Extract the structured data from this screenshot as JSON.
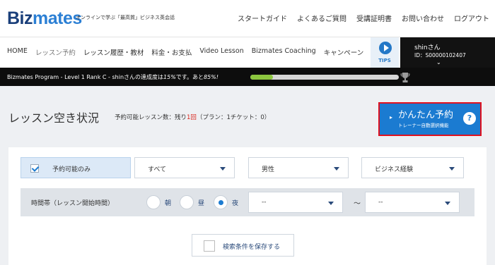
{
  "brand": {
    "logo_main": "Biz",
    "logo_accent": "mates",
    "tagline": "オンラインで学ぶ「最高質」ビジネス英会話"
  },
  "top_links": [
    "スタートガイド",
    "よくあるご質問",
    "受講証明書",
    "お問い合わせ",
    "ログアウト"
  ],
  "nav": {
    "items": [
      "HOME",
      "レッスン予約",
      "レッスン履歴・教材",
      "料金・お支払",
      "Video Lesson",
      "Bizmates Coaching",
      "キャンペーン"
    ],
    "tips_label": "TIPS",
    "user_name": "shinさん",
    "user_id": "ID：S00000102407"
  },
  "progress": {
    "text_prefix": "Bizmates Program - Level 1 Rank C - shinさんの達成度は",
    "achieved": "15%",
    "text_middle": "です。あと",
    "remaining": "85%!",
    "fraction": 0.15
  },
  "page": {
    "title": "レッスン空き状況",
    "remaining_prefix": "予約可能レッスン数：残り",
    "remaining_count": "1回",
    "remaining_suffix": "（プラン：1チケット：0）"
  },
  "reserve": {
    "main": "かんたん予約",
    "sub": "トレーナー自動選択機能",
    "help": "?"
  },
  "filters": {
    "available_only": "予約可能のみ",
    "select_all": "すべて",
    "gender": "男性",
    "experience": "ビジネス経験"
  },
  "time": {
    "label": "時間帯（レッスン開始時間）",
    "morning": "朝",
    "noon": "昼",
    "night": "夜",
    "selected": "夜",
    "from": "--",
    "to": "--",
    "separator": "〜"
  },
  "save_search": "検索条件を保存する"
}
